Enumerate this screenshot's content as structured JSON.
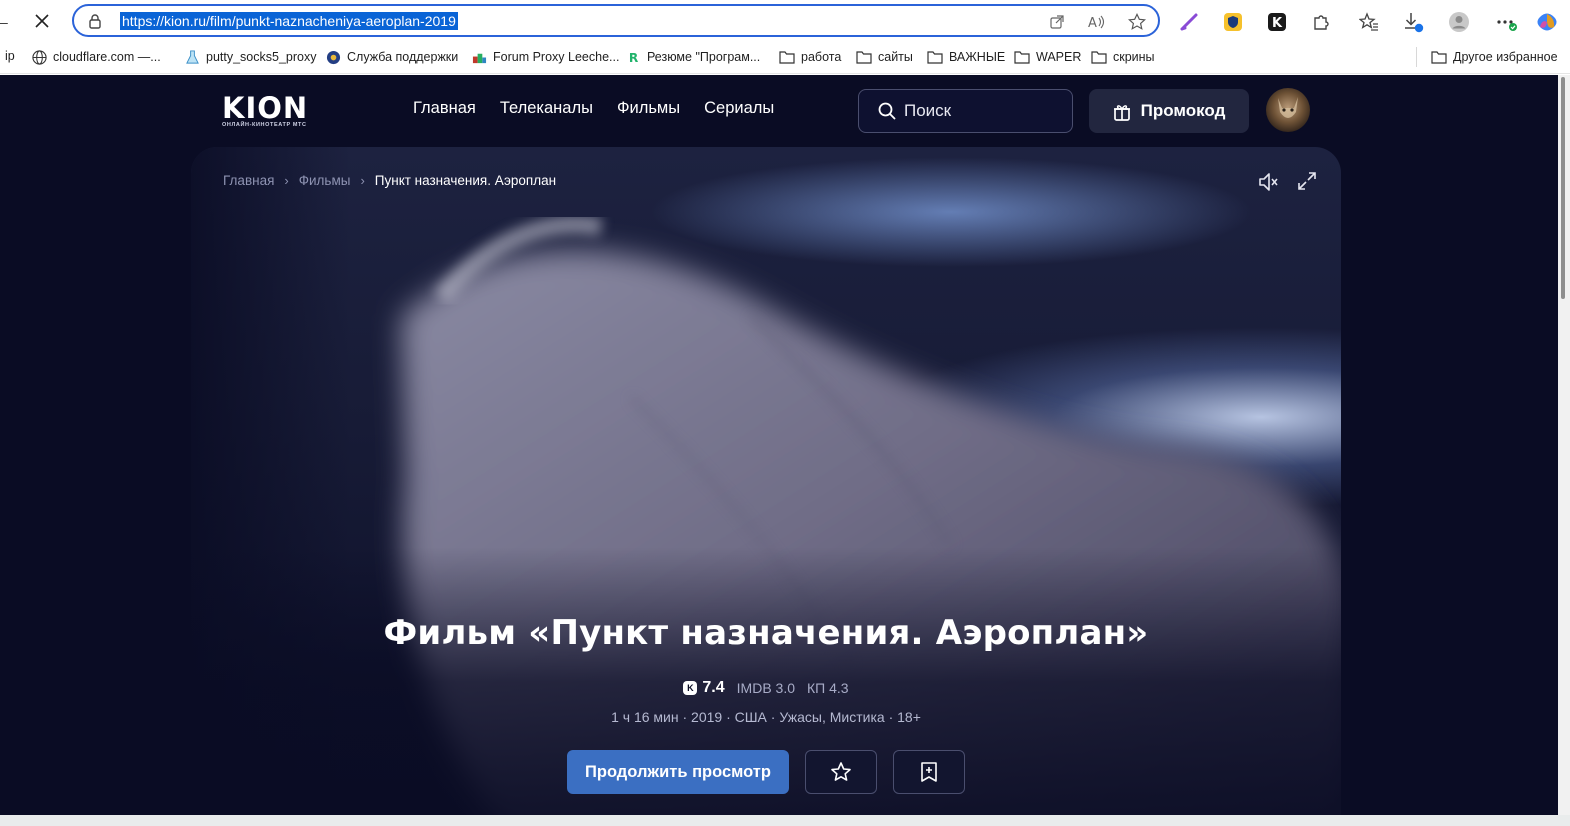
{
  "browser": {
    "url": "https://kion.ru/film/punkt-naznacheniya-aeroplan-2019",
    "edge_text": "ip",
    "bookmarks": [
      {
        "label": "cloudflare.com —...",
        "icon": "globe-icon"
      },
      {
        "label": "putty_socks5_proxy",
        "icon": "flask-icon"
      },
      {
        "label": "Служба поддержки",
        "icon": "support-icon"
      },
      {
        "label": "Forum Proxy Leeche...",
        "icon": "forum-icon"
      },
      {
        "label": "Резюме \"Програм...",
        "icon": "r-icon"
      },
      {
        "label": "работа",
        "icon": "folder-icon"
      },
      {
        "label": "сайты",
        "icon": "folder-icon"
      },
      {
        "label": "ВАЖНЫЕ",
        "icon": "folder-icon"
      },
      {
        "label": "WAPER",
        "icon": "folder-icon"
      },
      {
        "label": "скрины",
        "icon": "folder-icon"
      }
    ],
    "other_favorites": "Другое избранное"
  },
  "site": {
    "logo_word": "KION",
    "logo_sub": "ОНЛАЙН-КИНОТЕАТР МТС",
    "nav": [
      "Главная",
      "Телеканалы",
      "Фильмы",
      "Сериалы"
    ],
    "search_placeholder": "Поиск",
    "promo_label": "Промокод"
  },
  "hero": {
    "breadcrumbs": [
      "Главная",
      "Фильмы",
      "Пункт назначения. Аэроплан"
    ],
    "title": "Фильм «Пункт назначения. Аэроплан»",
    "kion_rating": "7.4",
    "imdb": "IMDB 3.0",
    "kp": "КП 4.3",
    "meta": "1 ч 16 мин · 2019 · США · Ужасы, Мистика · 18+",
    "continue_label": "Продолжить просмотр"
  },
  "colors": {
    "page_bg": "#0a0c24",
    "accent": "#3b6fc2",
    "address_border": "#2b63d9"
  }
}
